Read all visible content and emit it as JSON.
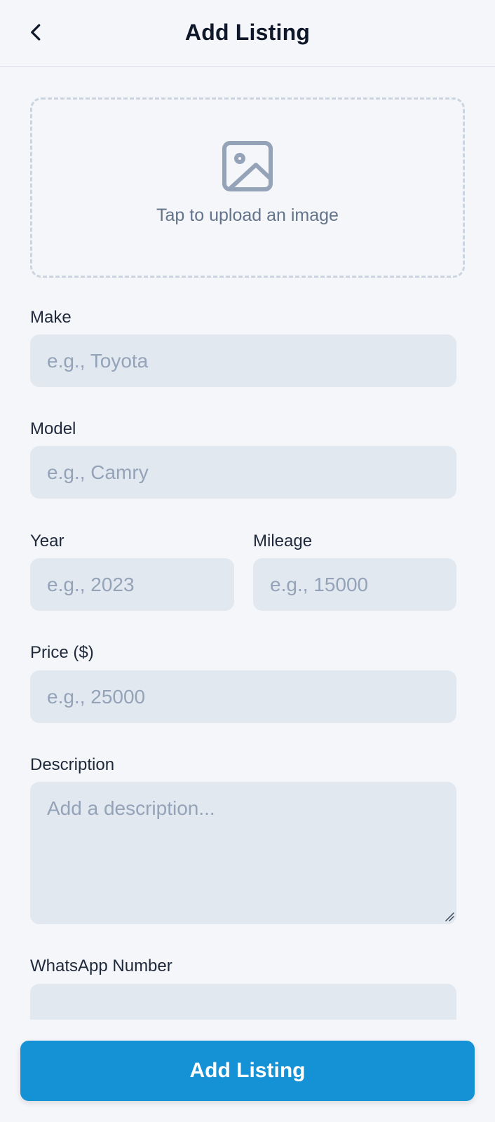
{
  "header": {
    "title": "Add Listing",
    "back_icon": "chevron-left-icon"
  },
  "upload": {
    "icon": "image-icon",
    "text": "Tap to upload an image"
  },
  "form": {
    "make": {
      "label": "Make",
      "placeholder": "e.g., Toyota",
      "value": ""
    },
    "model": {
      "label": "Model",
      "placeholder": "e.g., Camry",
      "value": ""
    },
    "year": {
      "label": "Year",
      "placeholder": "e.g., 2023",
      "value": ""
    },
    "mileage": {
      "label": "Mileage",
      "placeholder": "e.g., 15000",
      "value": ""
    },
    "price": {
      "label": "Price ($)",
      "placeholder": "e.g., 25000",
      "value": ""
    },
    "description": {
      "label": "Description",
      "placeholder": "Add a description...",
      "value": ""
    },
    "whatsapp": {
      "label": "WhatsApp Number",
      "placeholder": "",
      "value": ""
    }
  },
  "footer": {
    "submit_label": "Add Listing"
  },
  "colors": {
    "background": "#f5f6f9",
    "input_background": "#e2e8f0",
    "primary": "#1592d6",
    "placeholder": "#94a3b8",
    "text": "#0f172a"
  }
}
